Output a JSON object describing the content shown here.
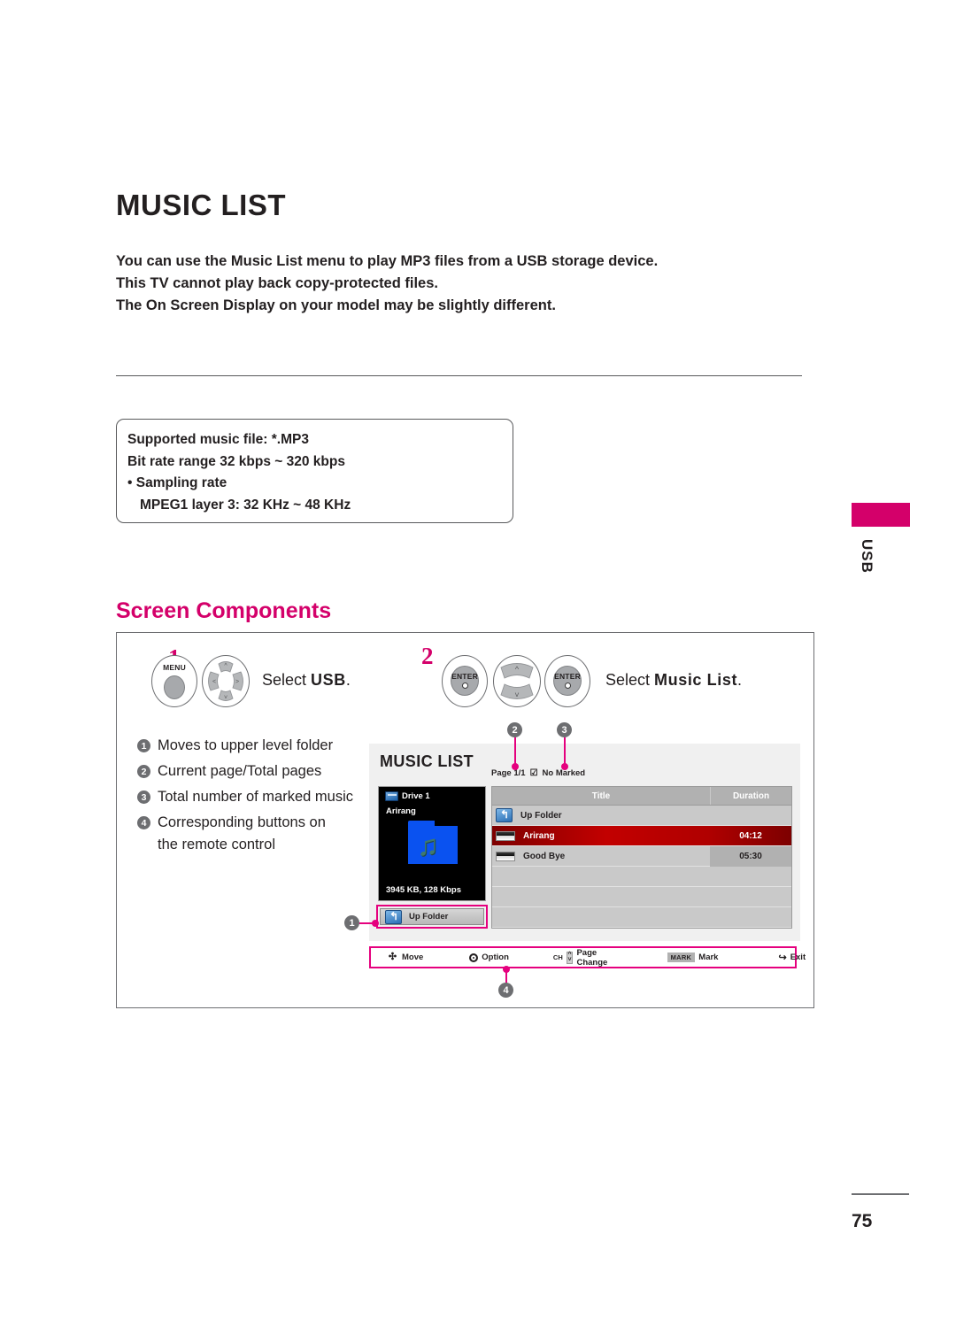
{
  "document": {
    "title": "MUSIC LIST",
    "intro_lines": [
      "You can use the Music List menu to play MP3 files from a USB storage device.",
      "This TV cannot play back copy-protected files.",
      "The On Screen Display on your model may be slightly different."
    ],
    "page_number": "75",
    "side_tab_label": "USB",
    "accent_color": "#d4006a",
    "callout_color": "#e5007e"
  },
  "spec_box": {
    "lines": [
      "Supported music file: *.MP3",
      "Bit rate range 32 kbps ~ 320 kbps",
      "• Sampling rate",
      "MPEG1 layer 3: 32 KHz ~ 48 KHz"
    ]
  },
  "section": {
    "heading": "Screen Components"
  },
  "steps": [
    {
      "number": "1",
      "buttons": [
        "MENU",
        "nav-pad"
      ],
      "label_prefix": "Select ",
      "label_bold": "USB",
      "label_suffix": "."
    },
    {
      "number": "2",
      "buttons": [
        "ENTER",
        "updown-pad",
        "ENTER"
      ],
      "label_prefix": "Select ",
      "label_bold": "Music List",
      "label_suffix": "."
    }
  ],
  "step1": {
    "menu_button_label": "MENU",
    "label_prefix": "Select ",
    "label_bold": "USB",
    "label_suffix": ".",
    "number": "1"
  },
  "step2": {
    "enter_button_label": "ENTER",
    "label_prefix": "Select ",
    "label_bold": "Music List",
    "label_suffix": ".",
    "number": "2"
  },
  "legend": {
    "items": [
      {
        "badge": "1",
        "text": "Moves to upper level folder"
      },
      {
        "badge": "2",
        "text": "Current page/Total pages"
      },
      {
        "badge": "3",
        "text": "Total number of marked music"
      },
      {
        "badge": "4",
        "text": "Corresponding buttons on"
      },
      {
        "badge": "",
        "text": "the remote control"
      }
    ]
  },
  "osd": {
    "title": "MUSIC LIST",
    "page_indicator": "Page 1/1",
    "marked_indicator": "No Marked",
    "marked_checkbox_glyph": "☑",
    "preview": {
      "drive_label": "Drive 1",
      "file_name": "Arirang",
      "file_meta": "3945 KB, 128 Kbps"
    },
    "up_folder_button_label": "Up Folder",
    "list": {
      "columns": [
        "Title",
        "Duration"
      ],
      "rows": [
        {
          "title": "Up Folder",
          "duration": "",
          "icon": "up-folder-icon",
          "state": "normal"
        },
        {
          "title": "Arirang",
          "duration": "04:12",
          "icon": "music-file-icon",
          "state": "selected"
        },
        {
          "title": "Good Bye",
          "duration": "05:30",
          "icon": "music-file-icon",
          "state": "alt"
        },
        {
          "title": "",
          "duration": "",
          "icon": "",
          "state": "empty"
        },
        {
          "title": "",
          "duration": "",
          "icon": "",
          "state": "empty"
        },
        {
          "title": "",
          "duration": "",
          "icon": "",
          "state": "empty"
        }
      ]
    },
    "keybar": [
      {
        "glyph": "move-icon",
        "label": "Move"
      },
      {
        "glyph": "option-icon",
        "label": "Option"
      },
      {
        "glyph": "ch-updown-icon",
        "prefix": "CH",
        "label": "Page Change"
      },
      {
        "glyph": "mark-chip",
        "chip": "MARK",
        "label": "Mark"
      },
      {
        "glyph": "exit-icon",
        "label": "Exit"
      }
    ]
  },
  "callouts": [
    {
      "id": "1",
      "target": "up-folder-button"
    },
    {
      "id": "2",
      "target": "page-indicator"
    },
    {
      "id": "3",
      "target": "marked-indicator"
    },
    {
      "id": "4",
      "target": "keybar"
    }
  ]
}
